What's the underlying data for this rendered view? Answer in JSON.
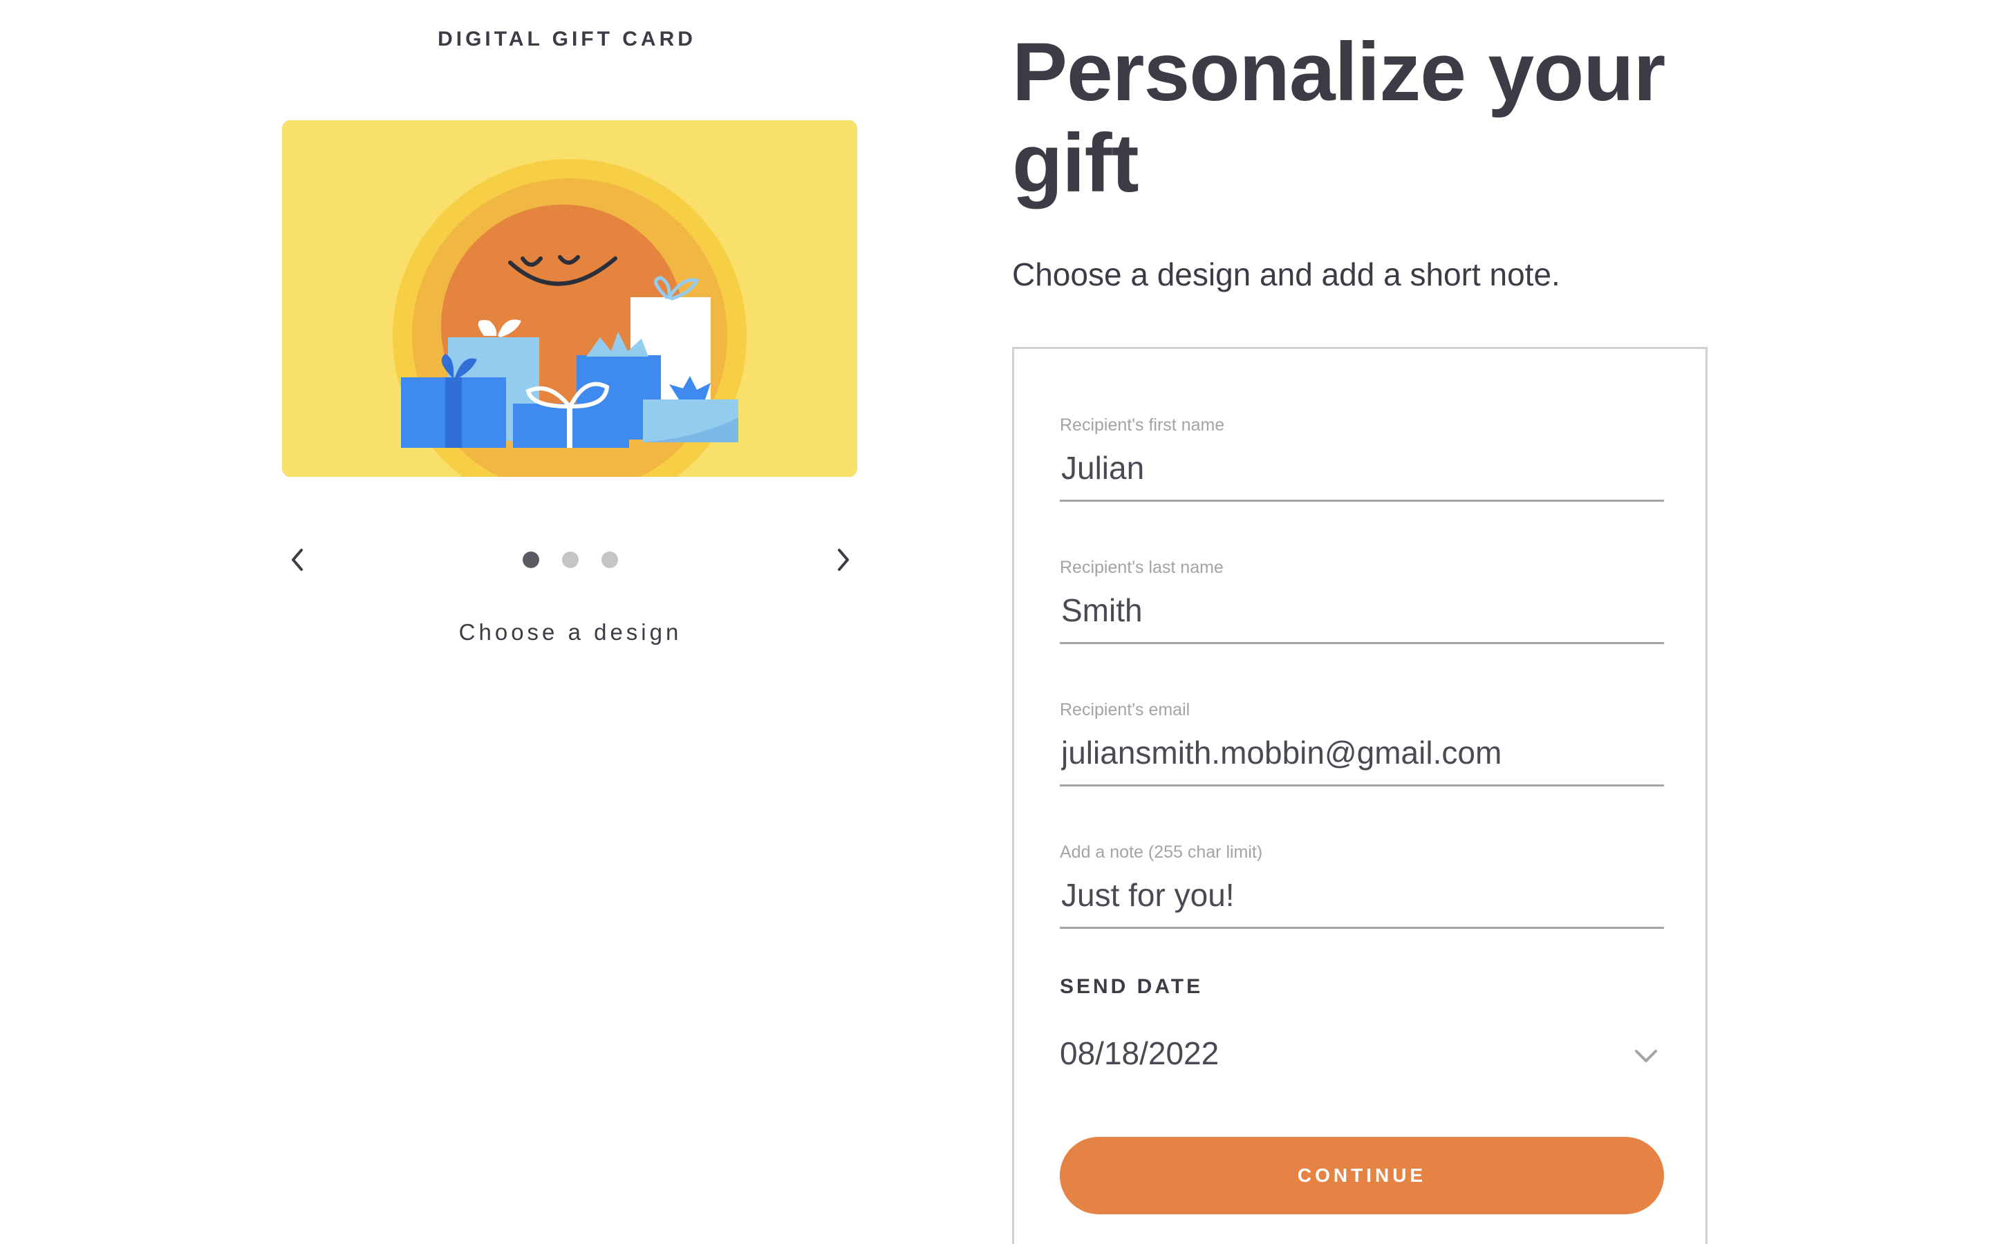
{
  "card_section": {
    "heading": "DIGITAL GIFT CARD",
    "selected_design_index": 1,
    "design_count": 3,
    "choose_label": "Choose a design",
    "art_colors": {
      "background": "#f9e06b",
      "sun_outer": "#f7cf45",
      "sun_middle": "#f2b742",
      "sun_inner": "#e4843f",
      "gift_blue": "#3f8af1",
      "gift_light_blue": "#93ccee",
      "gift_white": "#ffffff"
    }
  },
  "header": {
    "title": "Personalize your gift",
    "subtitle": "Choose a design and add a short note."
  },
  "form": {
    "first_name": {
      "label": "Recipient's first name",
      "value": "Julian"
    },
    "last_name": {
      "label": "Recipient's last name",
      "value": "Smith"
    },
    "email": {
      "label": "Recipient's email",
      "value": "juliansmith.mobbin@gmail.com"
    },
    "note": {
      "label": "Add a note (255 char limit)",
      "value": "Just for you!"
    },
    "send_date": {
      "label": "SEND DATE",
      "value": "08/18/2022"
    },
    "continue_label": "CONTINUE"
  },
  "colors": {
    "accent": "#e58345",
    "text": "#3c3c46",
    "muted": "#a3a3a8",
    "border": "#d2d2d2"
  }
}
